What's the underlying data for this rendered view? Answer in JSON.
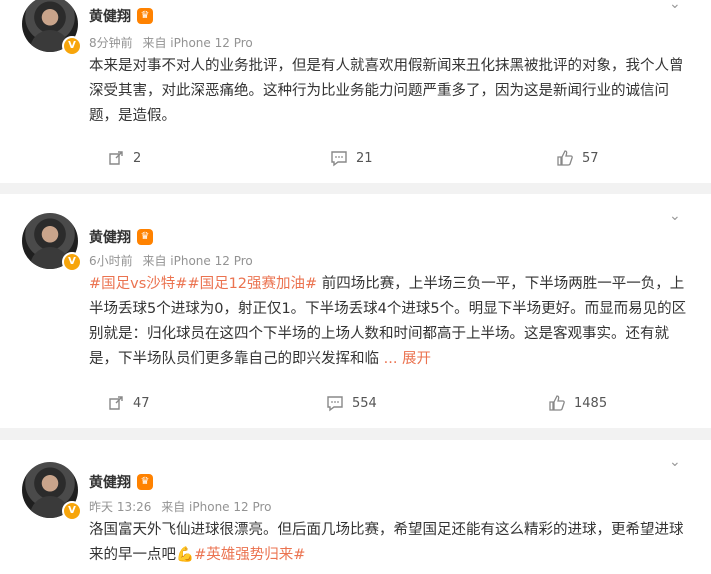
{
  "posts": [
    {
      "author": "黄健翔",
      "meta_time": "8分钟前",
      "meta_source": "来自 iPhone 12 Pro",
      "text": "本来是对事不对人的业务批评，但是有人就喜欢用假新闻来丑化抹黑被批评的对象，我个人曾深受其害，对此深恶痛绝。这种行为比业务能力问题严重多了，因为这是新闻行业的诚信问题，是造假。",
      "repost_count": "2",
      "comment_count": "21",
      "like_count": "57"
    },
    {
      "author": "黄健翔",
      "meta_time": "6小时前",
      "meta_source": "来自 iPhone 12 Pro",
      "tags": [
        "#国足vs沙特#",
        "#国足12强赛加油#"
      ],
      "text": " 前四场比赛，上半场三负一平，下半场两胜一平一负，上半场丢球5个进球为0，射正仅1。下半场丢球4个进球5个。明显下半场更好。而显而易见的区别就是：归化球员在这四个下半场的上场人数和时间都高于上半场。这是客观事实。还有就是，下半场队员们更多靠自己的即兴发挥和临",
      "more_label": "... 展开",
      "repost_count": "47",
      "comment_count": "554",
      "like_count": "1485"
    },
    {
      "author": "黄健翔",
      "meta_time": "昨天 13:26",
      "meta_source": "来自 iPhone 12 Pro",
      "text": "洛国富天外飞仙进球很漂亮。但后面几场比赛，希望国足还能有这么精彩的进球，更希望进球来的早一点吧",
      "emoji": "💪",
      "tag": "#英雄强势归来#"
    }
  ],
  "colors": {
    "accent": "#eb7350",
    "vip": "#ff8200",
    "bg": "#f2f2f2"
  },
  "icons": [
    "repost-icon",
    "comment-icon",
    "like-icon",
    "chevron-down-icon",
    "vip-badge-icon",
    "verified-icon"
  ]
}
